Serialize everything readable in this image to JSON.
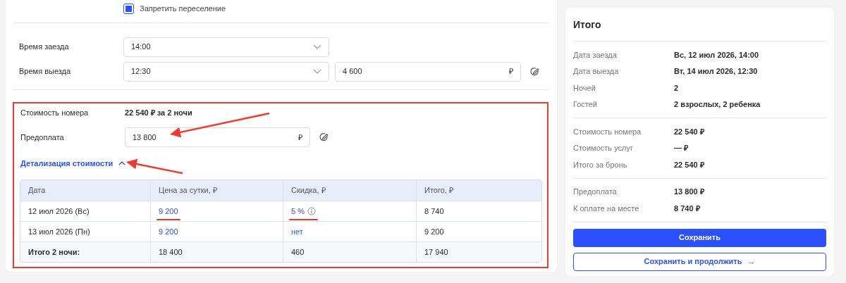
{
  "options": [
    {
      "label": "Запретить переселение",
      "checked": true
    }
  ],
  "times": [
    {
      "label": "Время заезда",
      "value": "14:00"
    },
    {
      "label": "Время выезда",
      "value": "12:30",
      "amount": {
        "value": "4 600",
        "currency": "₽"
      }
    }
  ],
  "cost_section": {
    "highlighted": true,
    "room_cost": {
      "label": "Стоимость номера",
      "value": "22 540 ₽ за 2 ночи"
    },
    "prepayment": {
      "label": "Предоплата",
      "value": "13 800",
      "currency": "₽",
      "arrow": true
    },
    "details_toggle": {
      "label": "Детализация стоимости",
      "expanded": true,
      "arrow": true
    },
    "table": {
      "columns": [
        "Дата",
        "Цена за сутки, ₽",
        "Скидка, ₽",
        "Итого, ₽"
      ],
      "rows": [
        {
          "kind": "day",
          "cells": [
            {
              "text": "12 июл 2026 (Вс)"
            },
            {
              "text": "9 200",
              "kind": "link",
              "underlined": true
            },
            {
              "text": "5 %",
              "kind": "link",
              "info": true,
              "underlined": true
            },
            {
              "text": "8 740"
            }
          ]
        },
        {
          "kind": "day",
          "cells": [
            {
              "text": "13 июл 2026 (Пн)"
            },
            {
              "text": "9 200",
              "kind": "link",
              "underlined": false
            },
            {
              "text": "нет",
              "kind": "link",
              "underlined": false
            },
            {
              "text": "9 200"
            }
          ]
        },
        {
          "kind": "total",
          "cells": [
            {
              "text": "Итого 2 ночи:"
            },
            {
              "text": "18 400"
            },
            {
              "text": "460"
            },
            {
              "text": "17 940"
            }
          ]
        }
      ]
    }
  },
  "summary": {
    "title": "Итого",
    "groups": [
      [
        {
          "label": "Дата заезда",
          "value": "Вс, 12 июл 2026, 14:00"
        },
        {
          "label": "Дата выезда",
          "value": "Вт, 14 июл 2026, 12:30"
        },
        {
          "label": "Ночей",
          "value": "2"
        },
        {
          "label": "Гостей",
          "value": "2 взрослых, 2 ребенка"
        }
      ],
      [
        {
          "label": "Стоимость номера",
          "value": "22 540 ₽"
        },
        {
          "label": "Стоимость услуг",
          "value": "— ₽"
        },
        {
          "label": "Итого за бронь",
          "value": "22 540 ₽"
        }
      ],
      [
        {
          "label": "Предоплата",
          "value": "13 800 ₽"
        },
        {
          "label": "К оплате на месте",
          "value": "8 740 ₽"
        }
      ]
    ]
  },
  "buttons": [
    {
      "label": "Сохранить",
      "kind": "primary"
    },
    {
      "label": "Сохранить и продолжить",
      "kind": "outline",
      "icon": "→"
    }
  ]
}
